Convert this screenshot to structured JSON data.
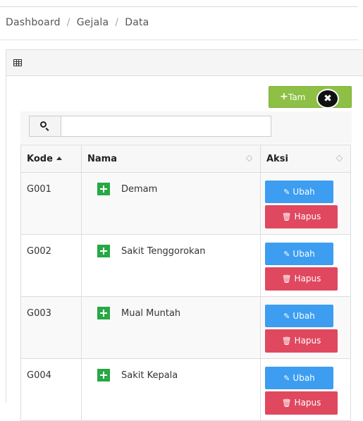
{
  "breadcrumb": [
    "Dashboard",
    "Gejala",
    "Data"
  ],
  "breadcrumb_separator": "/",
  "toolbar": {
    "add_label": "Tam",
    "add_icon": "plus-icon",
    "close_glyph": "✖"
  },
  "search": {
    "value": "",
    "placeholder": ""
  },
  "table": {
    "headers": {
      "kode": "Kode",
      "nama": "Nama",
      "aksi": "Aksi"
    },
    "rows": [
      {
        "kode": "G001",
        "nama": "Demam"
      },
      {
        "kode": "G002",
        "nama": "Sakit Tenggorokan"
      },
      {
        "kode": "G003",
        "nama": "Mual Muntah"
      },
      {
        "kode": "G004",
        "nama": "Sakit Kepala"
      }
    ],
    "ubah_label": "Ubah",
    "hapus_label": "Hapus"
  },
  "colors": {
    "add_button": "#8dc044",
    "ubah_button": "#3c9df1",
    "hapus_button": "#e0485f",
    "plus_icon": "#27a844"
  }
}
